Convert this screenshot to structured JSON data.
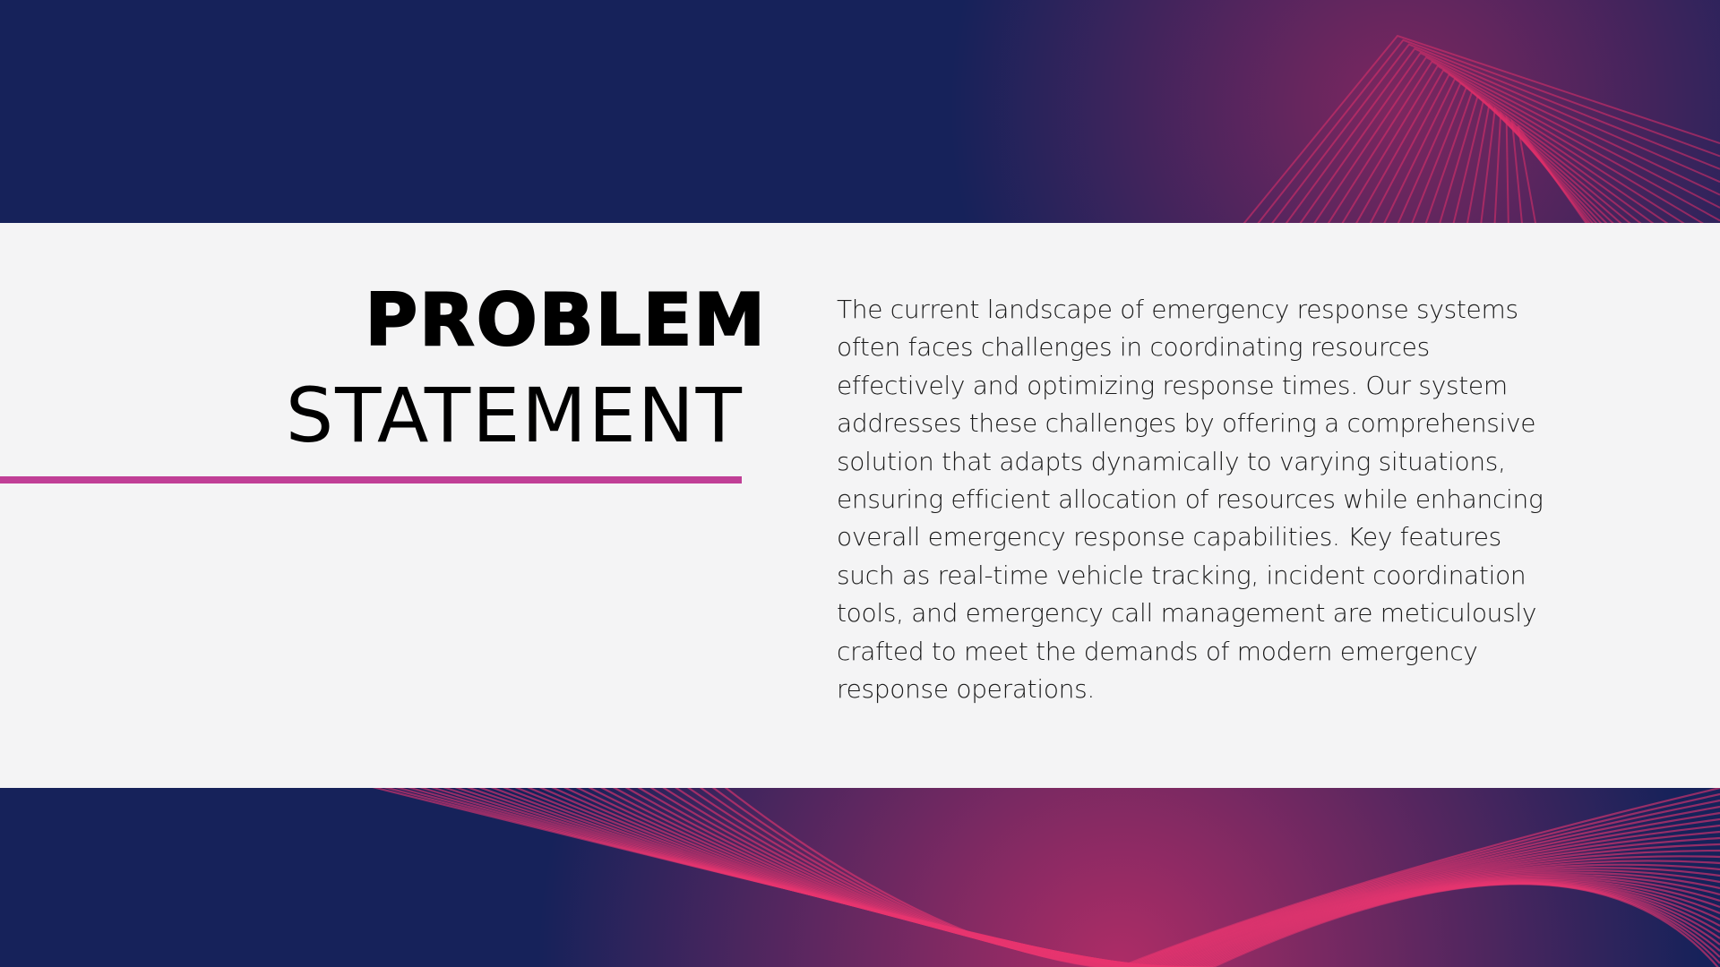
{
  "slide": {
    "title_line1": "PROBLEM",
    "title_line2": "STATEMENT",
    "body": "The current landscape of emergency response systems often faces challenges in coordinating resources effectively and optimizing response times. Our system addresses these challenges by offering a comprehensive solution that adapts dynamically to varying situations, ensuring efficient allocation of resources while enhancing overall emergency response capabilities. Key features such as real-time vehicle tracking, incident coordination tools, and emergency call management are meticulously crafted to meet the demands of modern emergency response operations."
  },
  "colors": {
    "background": "#16225a",
    "panel": "#f4f4f5",
    "accent": "#c03f96",
    "wave": "#e0306a",
    "text": "#000000"
  },
  "decoration": {
    "background_pattern": "pink-wave-lines"
  }
}
